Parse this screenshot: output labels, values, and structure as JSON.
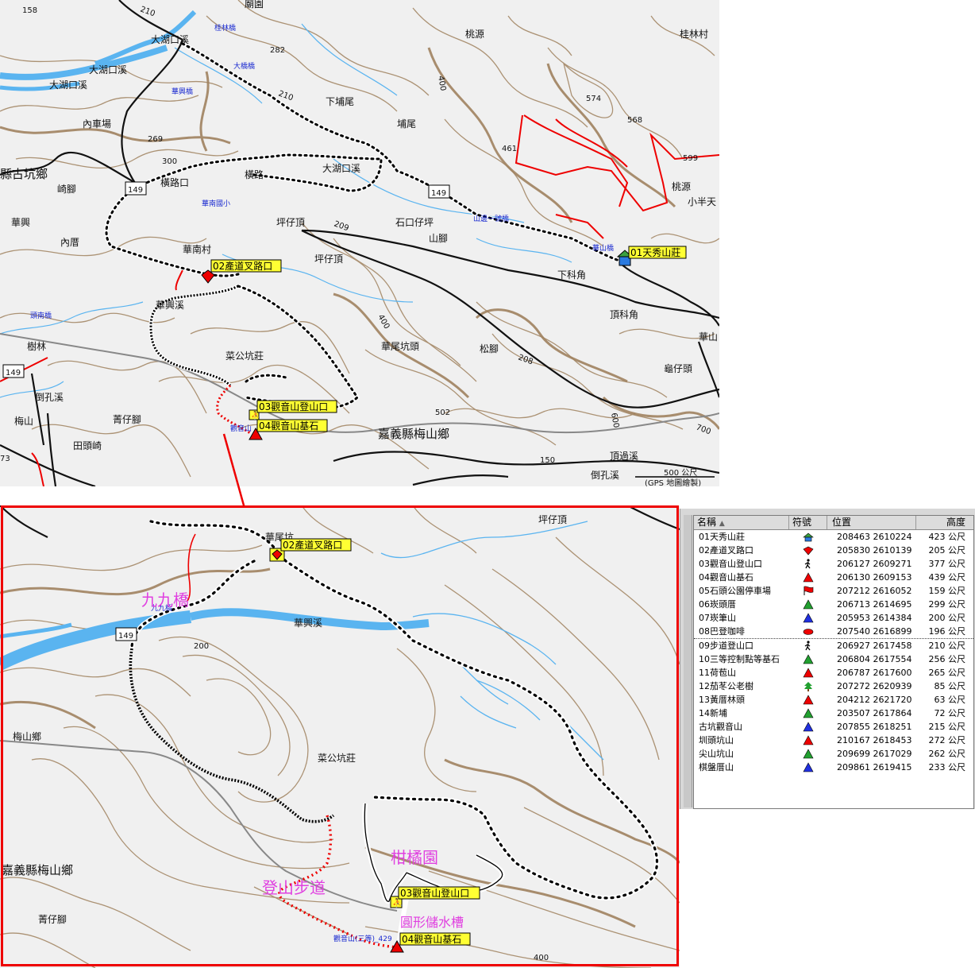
{
  "top_map": {
    "place_labels": [
      "大湖口溪",
      "大湖口溪",
      "大湖口溪",
      "內車場",
      "縣古坑鄉",
      "崎腳",
      "華興",
      "內厝",
      "橫路",
      "橫路口",
      "華南村",
      "華南國小",
      "大湖口溪",
      "下埔尾",
      "埔尾",
      "桃源",
      "桃源",
      "桂林村",
      "小半天",
      "石口仔坪",
      "山腳",
      "坪仔頂",
      "坪仔頂",
      "下科角",
      "頂科角",
      "華山",
      "華興溪",
      "菜公坑莊",
      "華尾坑頭",
      "松腳",
      "龜仔頭",
      "嘉義縣梅山鄉",
      "菁仔腳",
      "田頭崎",
      "梅山",
      "倒孔溪",
      "頂過溪",
      "倒孔溪",
      "樹林",
      "廟園"
    ],
    "bridge_labels": [
      "桂林橋",
      "大橋橋",
      "華興橋",
      "山邊一號橋",
      "華山橋",
      "觀音山",
      "頭南橋"
    ],
    "elevations": [
      "158",
      "282",
      "269",
      "300",
      "400",
      "574",
      "568",
      "461",
      "599",
      "502",
      "600",
      "700",
      "400",
      "73",
      "150",
      "149",
      "209",
      "208",
      "210",
      "210"
    ],
    "scale_label": "500 公尺",
    "credit": "(GPS 地圖繪製)"
  },
  "waypoint_tags": {
    "p01": "01天秀山莊",
    "p02": "02產道叉路口",
    "p03": "03觀音山登山口",
    "p04": "04觀音山基石"
  },
  "zoom_map": {
    "place_labels": [
      "坪仔頂",
      "華興溪",
      "菜公坑莊",
      "梅山鄉",
      "嘉義縣梅山鄉",
      "菁仔腳",
      "華尾坑"
    ],
    "elevations": [
      "200",
      "400",
      "149"
    ],
    "annotations": [
      "九九橋",
      "柑橘園",
      "登山步道",
      "圓形儲水槽"
    ],
    "bridge_label": "九九橋",
    "summit_label": "觀音山(三等)_429"
  },
  "table": {
    "headers": [
      "名稱",
      "符號",
      "位置",
      "高度"
    ],
    "rows": [
      {
        "name": "01天秀山莊",
        "icon": "house-icon",
        "pos": "208463 2610224",
        "elev": "423 公尺"
      },
      {
        "name": "02產道叉路口",
        "icon": "red-diamond-icon",
        "pos": "205830 2610139",
        "elev": "205 公尺"
      },
      {
        "name": "03觀音山登山口",
        "icon": "hiker-icon",
        "pos": "206127 2609271",
        "elev": "377 公尺"
      },
      {
        "name": "04觀音山基石",
        "icon": "red-triangle-icon",
        "pos": "206130 2609153",
        "elev": "439 公尺"
      },
      {
        "name": "05石頭公園停車場",
        "icon": "red-flag-icon",
        "pos": "207212 2616052",
        "elev": "159 公尺"
      },
      {
        "name": "06崁頭厝",
        "icon": "green-triangle-icon",
        "pos": "206713 2614695",
        "elev": "299 公尺"
      },
      {
        "name": "07崁筆山",
        "icon": "blue-triangle-icon",
        "pos": "205953 2614384",
        "elev": "200 公尺"
      },
      {
        "name": "08巴登咖啡",
        "icon": "red-ellipse-icon",
        "pos": "207540 2616899",
        "elev": "196 公尺"
      },
      {
        "name": "09步道登山口",
        "icon": "hiker-icon",
        "pos": "206927 2617458",
        "elev": "210 公尺"
      },
      {
        "name": "10三等控制點等基石",
        "icon": "green-triangle-icon",
        "pos": "206804 2617554",
        "elev": "256 公尺"
      },
      {
        "name": "11荷苞山",
        "icon": "red-triangle-icon",
        "pos": "206787 2617600",
        "elev": "265 公尺"
      },
      {
        "name": "12茄苳公老樹",
        "icon": "tree-icon",
        "pos": "207272 2620939",
        "elev": "85 公尺"
      },
      {
        "name": "13黃厝林頭",
        "icon": "red-triangle-icon",
        "pos": "204212 2621720",
        "elev": "63 公尺"
      },
      {
        "name": "14新埔",
        "icon": "green-triangle-icon",
        "pos": "203507 2617864",
        "elev": "72 公尺"
      },
      {
        "name": "古坑觀音山",
        "icon": "blue-triangle-icon",
        "pos": "207855 2618251",
        "elev": "215 公尺"
      },
      {
        "name": "圳頭坑山",
        "icon": "red-triangle-icon",
        "pos": "210167 2618453",
        "elev": "272 公尺"
      },
      {
        "name": "尖山坑山",
        "icon": "green-triangle-icon",
        "pos": "209699 2617029",
        "elev": "262 公尺"
      },
      {
        "name": "棋盤厝山",
        "icon": "blue-triangle-icon",
        "pos": "209861 2619415",
        "elev": "233 公尺"
      }
    ]
  },
  "colors": {
    "contour": "#a08060",
    "river": "#5ab4f0",
    "road": "#111111",
    "gray_road": "#888888",
    "boundary": "#ee0000",
    "trail": "#ee0000",
    "highlight": "#ffff33",
    "annotation": "#e040e0"
  }
}
